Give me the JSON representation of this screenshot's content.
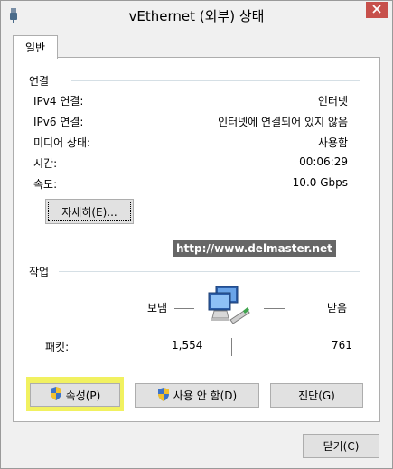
{
  "window": {
    "title": "vEthernet (외부) 상태"
  },
  "tabs": [
    {
      "label": "일반"
    }
  ],
  "connection": {
    "group_title": "연결",
    "rows": [
      {
        "label": "IPv4 연결:",
        "value": "인터넷"
      },
      {
        "label": "IPv6 연결:",
        "value": "인터넷에 연결되어 있지 않음"
      },
      {
        "label": "미디어 상태:",
        "value": "사용함"
      },
      {
        "label": "시간:",
        "value": "00:06:29"
      },
      {
        "label": "속도:",
        "value": "10.0 Gbps"
      }
    ],
    "details_button": "자세히(E)..."
  },
  "watermark": "http://www.delmaster.net",
  "activity": {
    "group_title": "작업",
    "sent_label": "보냄",
    "received_label": "받음",
    "packets_label": "패킷:",
    "packets_sent": "1,554",
    "packets_received": "761"
  },
  "buttons": {
    "properties": "속성(P)",
    "disable": "사용 안 함(D)",
    "diagnose": "진단(G)",
    "close": "닫기(C)"
  },
  "colors": {
    "highlight": "#f1f160",
    "close_button": "#c7504b"
  },
  "icons": [
    "network-adapter-icon",
    "close-icon",
    "shield-icon",
    "network-computers-icon"
  ]
}
